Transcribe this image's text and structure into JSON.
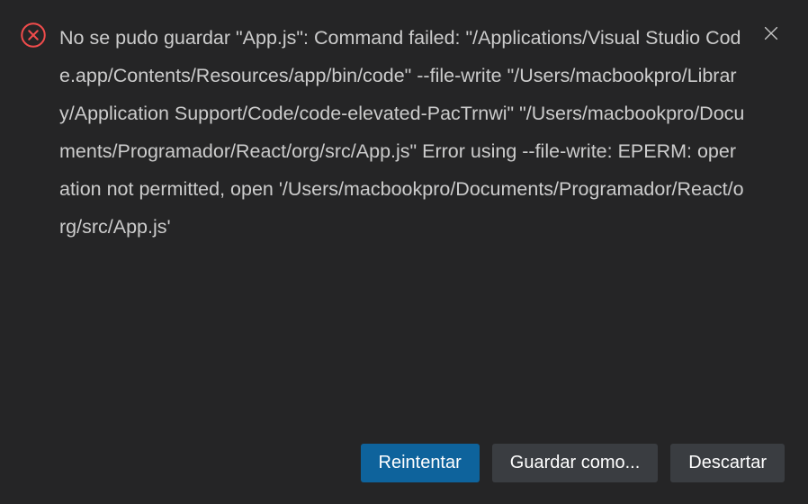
{
  "dialog": {
    "message": "No se pudo guardar \"App.js\": Command failed: \"/Applications/Visual Studio Code.app/Contents/Resources/app/bin/code\" --file-write \"/Users/macbookpro/Library/Application Support/Code/code-elevated-PacTrnwi\" \"/Users/macbookpro/Documents/Programador/React/org/src/App.js\" Error using --file-write: EPERM: operation not permitted, open '/Users/macbookpro/Documents/Programador/React/org/src/App.js'",
    "icon": "error-icon",
    "icon_color": "#f14c4c",
    "buttons": {
      "retry": "Reintentar",
      "save_as": "Guardar como...",
      "discard": "Descartar"
    }
  }
}
